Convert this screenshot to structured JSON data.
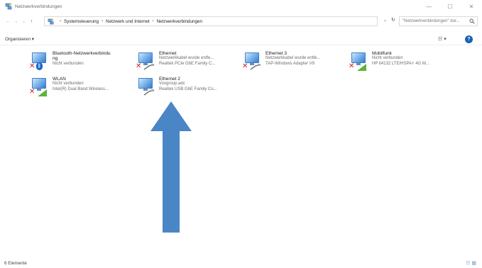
{
  "window": {
    "title": "Netzwerkverbindungen",
    "minimize": "—",
    "maximize": "☐",
    "close": "✕"
  },
  "nav": {
    "back": "←",
    "forward": "→",
    "recent": "⌄",
    "up": "↑"
  },
  "address": {
    "crumbs": [
      "Systemsteuerung",
      "Netzwerk und Internet",
      "Netzwerkverbindungen"
    ],
    "separator": "›",
    "dropdown": "⌄",
    "refresh": "↻"
  },
  "search": {
    "text": "\"Netzwerkverbindungen\" dur..."
  },
  "commandbar": {
    "organize": "Organisieren ▾",
    "view": "☷ ▾",
    "help": "?"
  },
  "items": [
    {
      "name": "Bluetooth-Netzwerkverbindu",
      "name2": "ng",
      "status": "Nicht verbunden",
      "adapter": "",
      "kind": "bluetooth"
    },
    {
      "name": "Ethernet",
      "name2": "",
      "status": "Netzwerkkabel wurde entfe...",
      "adapter": "Realtek PCIe GbE Family C...",
      "kind": "ethernet"
    },
    {
      "name": "Ethernet 3",
      "name2": "",
      "status": "Netzwerkkabel wurde entfe...",
      "adapter": "TAP-Windows Adapter V9",
      "kind": "ethernet"
    },
    {
      "name": "Mobilfunk",
      "name2": "",
      "status": "Nicht verbunden",
      "adapter": "HP lt4132 LTE/HSPA+ 4G M...",
      "kind": "mobile"
    },
    {
      "name": "WLAN",
      "name2": "",
      "status": "Nicht verbunden",
      "adapter": "Intel(R) Dual Band Wireless...",
      "kind": "wifi"
    },
    {
      "name": "Ethernet 2",
      "name2": "",
      "status": "Voxgroup.adc",
      "adapter": "Realtek USB GbE Family Co...",
      "kind": "ethernet-ok"
    }
  ],
  "status": {
    "count": "6 Elemente",
    "views": "☷ ▦"
  },
  "colors": {
    "accent": "#1a5fb4",
    "arrow": "#4a86c5",
    "error": "#d21f1f"
  }
}
